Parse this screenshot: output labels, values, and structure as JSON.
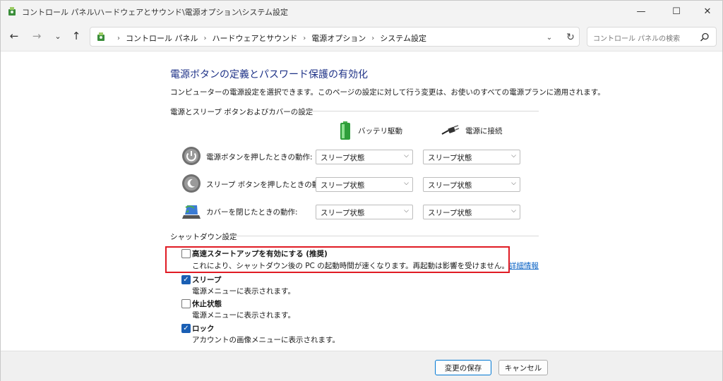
{
  "window": {
    "title": "コントロール パネル\\ハードウェアとサウンド\\電源オプション\\システム設定",
    "minimize_glyph": "—",
    "maximize_glyph": "☐",
    "close_glyph": "✕"
  },
  "nav": {
    "back_glyph": "←",
    "forward_glyph": "→",
    "recent_glyph": "⌄",
    "up_glyph": "↑",
    "breadcrumbs": [
      "コントロール パネル",
      "ハードウェアとサウンド",
      "電源オプション",
      "システム設定"
    ],
    "crumb_separator": "›",
    "dropdown_glyph": "⌄",
    "refresh_glyph": "↻",
    "search_placeholder": "コントロール パネルの検索"
  },
  "page": {
    "title": "電源ボタンの定義とパスワード保護の有効化",
    "description": "コンピューターの電源設定を選択できます。このページの設定に対して行う変更は、お使いのすべての電源プランに適用されます。"
  },
  "buttons_section": {
    "header": "電源とスリープ ボタンおよびカバーの設定",
    "col_battery": "バッテリ駆動",
    "col_plugged": "電源に接続",
    "rows": [
      {
        "label": "電源ボタンを押したときの動作:",
        "battery": "スリープ状態",
        "plugged": "スリープ状態",
        "icon": "power-button-icon"
      },
      {
        "label": "スリープ ボタンを押したときの動作:",
        "battery": "スリープ状態",
        "plugged": "スリープ状態",
        "icon": "sleep-button-icon"
      },
      {
        "label": "カバーを閉じたときの動作:",
        "battery": "スリープ状態",
        "plugged": "スリープ状態",
        "icon": "laptop-lid-icon"
      }
    ]
  },
  "shutdown_section": {
    "header": "シャットダウン設定",
    "options": [
      {
        "title": "高速スタートアップを有効にする (推奨)",
        "desc": "これにより、シャットダウン後の PC の起動時間が速くなります。再起動は影響を受けません。",
        "link": "詳細情報",
        "checked": false
      },
      {
        "title": "スリープ",
        "desc": "電源メニューに表示されます。",
        "checked": true
      },
      {
        "title": "休止状態",
        "desc": "電源メニューに表示されます。",
        "checked": false
      },
      {
        "title": "ロック",
        "desc": "アカウントの画像メニューに表示されます。",
        "checked": true
      }
    ]
  },
  "footer": {
    "save_label": "変更の保存",
    "cancel_label": "キャンセル"
  },
  "colors": {
    "title_blue": "#1e3287",
    "link_blue": "#0b63c5",
    "checkbox_blue": "#1a5fb4",
    "highlight_red": "#e01b24"
  }
}
